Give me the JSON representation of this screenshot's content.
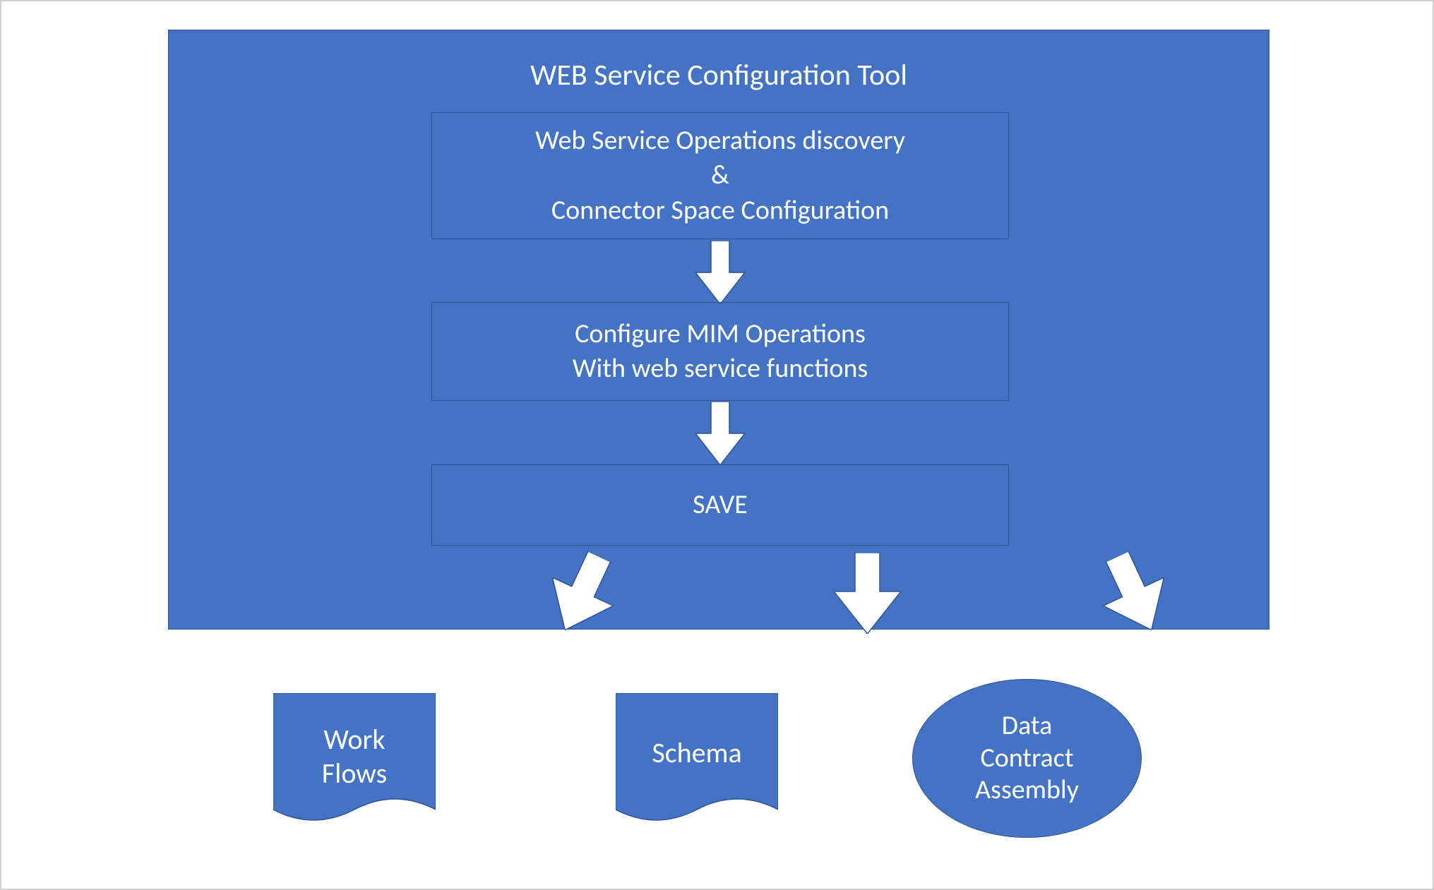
{
  "colors": {
    "primary": "#4472c4",
    "border": "#2e5395",
    "text_on_primary": "#ffffff",
    "arrow_fill": "#ffffff"
  },
  "main": {
    "title": "WEB Service Configuration Tool",
    "step1_line1": "Web Service Operations discovery",
    "step1_line2": "&",
    "step1_line3": "Connector Space Configuration",
    "step2_line1": "Configure MIM Operations",
    "step2_line2": "With web service functions",
    "step3": "SAVE"
  },
  "outputs": {
    "workflows_line1": "Work",
    "workflows_line2": "Flows",
    "schema": "Schema",
    "data_line1": "Data",
    "data_line2": "Contract",
    "data_line3": "Assembly"
  }
}
